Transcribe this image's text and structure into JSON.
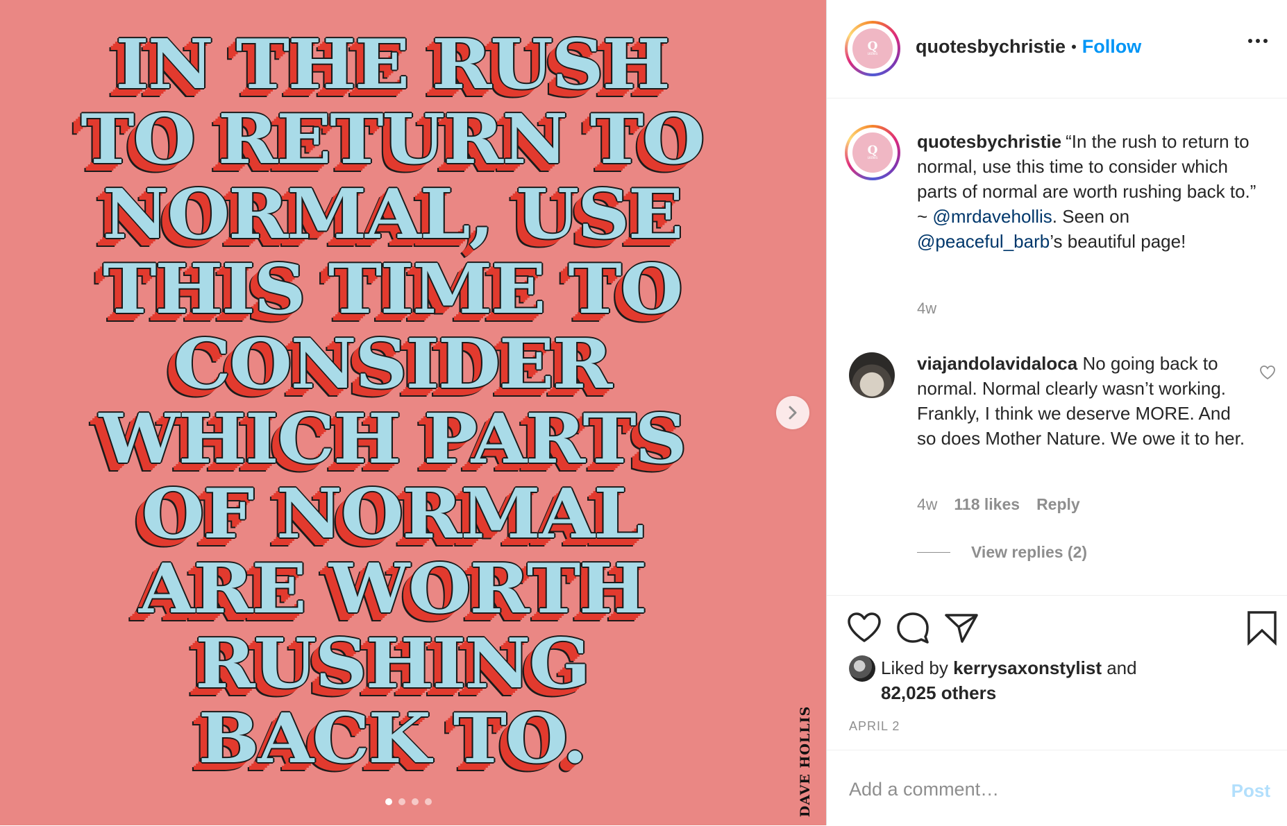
{
  "media": {
    "quote_lines": [
      "IN THE RUSH",
      "TO RETURN TO",
      "NORMAL, USE",
      "THIS TIME TO",
      "CONSIDER",
      "WHICH PARTS",
      "OF NORMAL",
      "ARE WORTH",
      "RUSHING",
      "BACK TO."
    ],
    "credit": "DAVE HOLLIS",
    "carousel_dots": 4,
    "active_dot": 1
  },
  "header": {
    "username": "quotesbychristie",
    "separator": "•",
    "follow_label": "Follow",
    "more_icon": "more-horizontal-icon"
  },
  "caption": {
    "username": "quotesbychristie",
    "text_part1": "“In the rush to return to normal, use this time to consider which parts of normal are worth rushing back to.” ~ ",
    "mention1": "@mrdavehollis",
    "text_part2": ". Seen on ",
    "mention2": "@peaceful_barb",
    "text_part3": "’s beautiful page!",
    "time": "4w"
  },
  "comment": {
    "username": "viajandolavidaloca",
    "text": "No going back to normal. Normal clearly wasn’t working. Frankly, I think we deserve MORE. And so does Mother Nature. We owe it to her.",
    "time": "4w",
    "likes": "118 likes",
    "reply_label": "Reply",
    "view_replies": "View replies (2)"
  },
  "actions": {
    "liked_prefix": "Liked by ",
    "liked_user": "kerrysaxonstylist",
    "liked_and": " and",
    "others": "82,025 others",
    "date": "APRIL 2"
  },
  "add_comment": {
    "placeholder": "Add a comment…",
    "post_label": "Post"
  },
  "colors": {
    "media_bg": "#ea8784",
    "quote_fill": "#a9dbe8",
    "quote_shadow": "#e23a2e",
    "link_blue": "#0095f6",
    "mention_blue": "#00376b",
    "post_disabled": "#b2dffc"
  }
}
